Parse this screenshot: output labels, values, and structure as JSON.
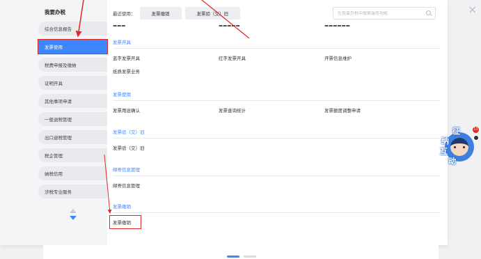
{
  "window": {
    "close_glyph": "×"
  },
  "sidebar": {
    "title": "我要办税",
    "items": [
      {
        "label": "综合信息报告",
        "active": false
      },
      {
        "label": "发票使用",
        "active": true
      },
      {
        "label": "税费申报及缴纳",
        "active": false
      },
      {
        "label": "证明开具",
        "active": false
      },
      {
        "label": "其他事项申请",
        "active": false
      },
      {
        "label": "一般退税管理",
        "active": false
      },
      {
        "label": "出口退税管理",
        "active": false
      },
      {
        "label": "税企管理",
        "active": false
      },
      {
        "label": "纳税信用",
        "active": false
      },
      {
        "label": "涉税专业服务",
        "active": false
      }
    ],
    "scroll_up_icon": "triangle-up-icon",
    "scroll_down_icon": "triangle-down-icon"
  },
  "recent": {
    "label": "最近使用：",
    "tags": [
      "发票缴销",
      "发票验（交）旧"
    ]
  },
  "search": {
    "placeholder": "在我要办税中搜索服务功能",
    "icon": "search-icon"
  },
  "sections": [
    {
      "title": "发票开具",
      "items": [
        "蓝字发票开具",
        "红字发票开具",
        "开票信息维护",
        "纸质发票业务"
      ]
    },
    {
      "title": "发票使用",
      "items": [
        "发票用途确认",
        "发票查询统计",
        "发票额度调整申请"
      ]
    },
    {
      "title": "发票验（交）旧",
      "items": [
        "发票验（交）旧"
      ]
    },
    {
      "title": "邮寄信息管理",
      "items": [
        "邮寄信息管理"
      ]
    },
    {
      "title": "发票缴销",
      "items": [
        "发票缴销"
      ]
    }
  ],
  "robot": {
    "characters": [
      "征",
      "纳",
      "互",
      "动"
    ],
    "badge": "11"
  },
  "colors": {
    "accent": "#3c86ff",
    "annotation": "#e32626"
  }
}
